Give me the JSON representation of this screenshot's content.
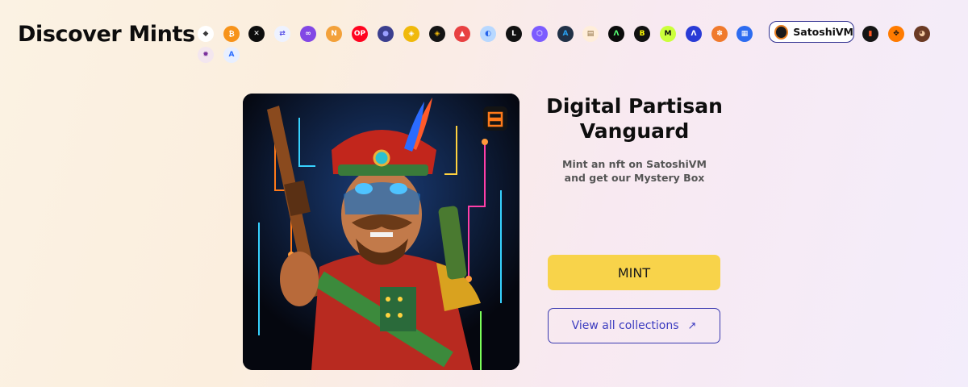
{
  "page": {
    "title": "Discover Mints"
  },
  "chains": {
    "selected_label": "SatoshiVM",
    "items": [
      {
        "name": "ethereum-icon",
        "color": "#ffffff",
        "glyph": "◆",
        "fg": "#3c3c3d"
      },
      {
        "name": "bitcoin-icon",
        "color": "#f7931a",
        "glyph": "₿",
        "fg": "#ffffff"
      },
      {
        "name": "immutable-icon",
        "color": "#0d0d0d",
        "glyph": "✕",
        "fg": "#ffffff"
      },
      {
        "name": "bridge-icon",
        "color": "#eef2ff",
        "glyph": "⇄",
        "fg": "#4f46e5"
      },
      {
        "name": "polygon-icon",
        "color": "#8247e5",
        "glyph": "∞",
        "fg": "#ffffff"
      },
      {
        "name": "nervos-icon",
        "color": "#f3a13a",
        "glyph": "N",
        "fg": "#ffffff"
      },
      {
        "name": "optimism-icon",
        "color": "#ff0420",
        "glyph": "OP",
        "fg": "#ffffff"
      },
      {
        "name": "sphere-icon",
        "color": "#3b3f8f",
        "glyph": "●",
        "fg": "#9aa0ff"
      },
      {
        "name": "bsc-icon",
        "color": "#f0b90b",
        "glyph": "◈",
        "fg": "#ffffff"
      },
      {
        "name": "core-icon",
        "color": "#141414",
        "glyph": "◈",
        "fg": "#f0b90b"
      },
      {
        "name": "avalanche-icon",
        "color": "#e84142",
        "glyph": "▲",
        "fg": "#ffffff"
      },
      {
        "name": "base-icon",
        "color": "#b8d8ff",
        "glyph": "◐",
        "fg": "#2563eb"
      },
      {
        "name": "linea-icon",
        "color": "#121212",
        "glyph": "L",
        "fg": "#ffffff"
      },
      {
        "name": "zora-icon",
        "color": "#7c5cff",
        "glyph": "⬡",
        "fg": "#ffffff"
      },
      {
        "name": "arbitrum-icon",
        "color": "#213147",
        "glyph": "A",
        "fg": "#28a0f0"
      },
      {
        "name": "scroll-icon",
        "color": "#ffeeda",
        "glyph": "▤",
        "fg": "#8a6a3a"
      },
      {
        "name": "dark-chain-icon",
        "color": "#0b0b0b",
        "glyph": "Λ",
        "fg": "#57ff74"
      },
      {
        "name": "blast-icon",
        "color": "#111111",
        "glyph": "B",
        "fg": "#fcfc03"
      },
      {
        "name": "mantle-icon",
        "color": "#cbff3b",
        "glyph": "M",
        "fg": "#111111"
      },
      {
        "name": "aptos-icon",
        "color": "#2a3bd6",
        "glyph": "Λ",
        "fg": "#ffffff"
      },
      {
        "name": "orange-chain-icon",
        "color": "#f07a2c",
        "glyph": "✽",
        "fg": "#ffffff"
      },
      {
        "name": "blue-chain-icon",
        "color": "#2d6cf0",
        "glyph": "▦",
        "fg": "#ffffff"
      },
      {
        "name": "satoshivm-icon",
        "color": "#1a1a1a",
        "glyph": "",
        "fg": "#ffffff"
      },
      {
        "name": "stack-icon",
        "color": "#151515",
        "glyph": "▮",
        "fg": "#ff5722"
      },
      {
        "name": "orange-dots-icon",
        "color": "#ff7b00",
        "glyph": "✥",
        "fg": "#111111"
      },
      {
        "name": "bear-icon",
        "color": "#6b3a24",
        "glyph": "◕",
        "fg": "#f0c8a0"
      },
      {
        "name": "gear-chain-icon",
        "color": "#f3e6ef",
        "glyph": "✹",
        "fg": "#7a2f9c"
      },
      {
        "name": "arbitrum-nova-icon",
        "color": "#e8efff",
        "glyph": "A",
        "fg": "#2b6dff"
      }
    ]
  },
  "nft": {
    "title": "Digital Partisan Vanguard",
    "subtitle_line1": "Mint an nft on SatoshiVM",
    "subtitle_line2": "and get our Mystery Box",
    "image_alt": "Digital Partisan Vanguard NFT artwork"
  },
  "actions": {
    "mint_label": "MINT",
    "view_all_label": "View all collections",
    "view_all_arrow": "↗"
  },
  "colors": {
    "accent_yellow": "#f8d34a",
    "accent_blue": "#3c3cc0"
  }
}
